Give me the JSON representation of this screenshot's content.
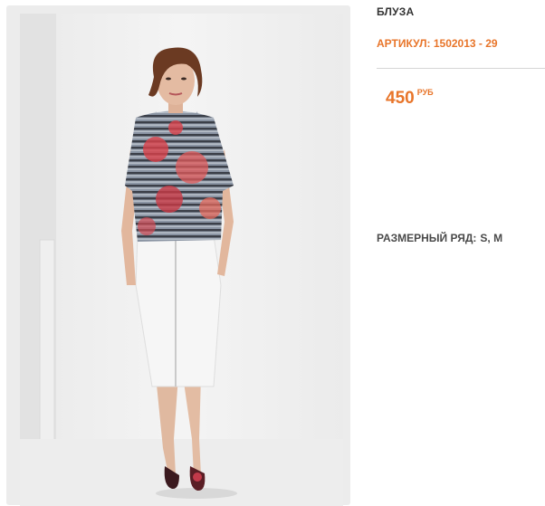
{
  "product": {
    "name": "БЛУЗА",
    "sku_label": "АРТИКУЛ:",
    "sku_value": "1502013 - 29",
    "price_value": "450",
    "price_currency": "РУБ",
    "sizes_label": "РАЗМЕРНЫЙ РЯД:",
    "sizes_value": "S, M"
  },
  "colors": {
    "accent": "#e8752a",
    "text": "#333333",
    "photo_frame": "#ececec"
  }
}
